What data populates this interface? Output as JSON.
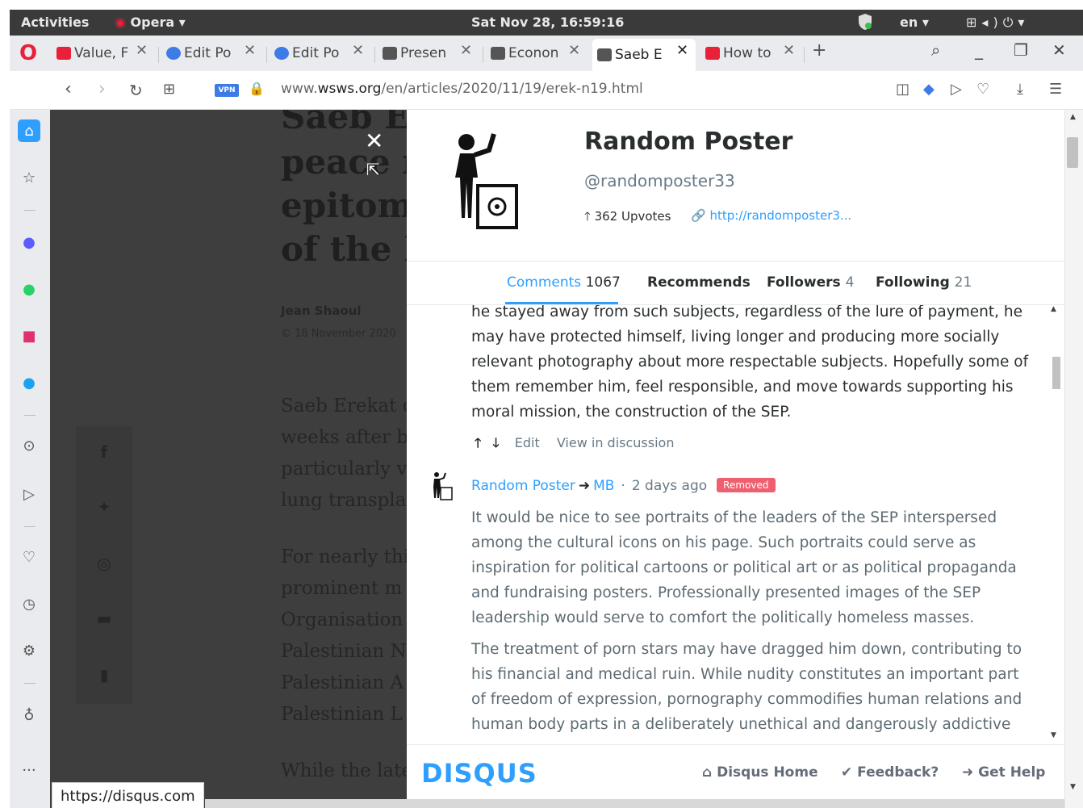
{
  "system_bar": {
    "activities": "Activities",
    "app_name": "Opera ▾",
    "clock": "Sat Nov 28, 16:59:16",
    "language": "en ▾"
  },
  "tabs": [
    {
      "label": "Value, F",
      "favicon": "youtube-icon",
      "color": "#e8203a"
    },
    {
      "label": "Edit Po",
      "favicon": "wordpress-icon",
      "color": "#3d7be6"
    },
    {
      "label": "Edit Po",
      "favicon": "wordpress-icon",
      "color": "#3d7be6"
    },
    {
      "label": "Presen",
      "favicon": "wsws-icon",
      "color": "#555"
    },
    {
      "label": "Econon",
      "favicon": "wsws-icon",
      "color": "#555"
    },
    {
      "label": "Saeb E",
      "favicon": "wsws-icon",
      "color": "#555",
      "active": true
    },
    {
      "label": "How to",
      "favicon": "youtube-icon",
      "color": "#e8203a"
    }
  ],
  "address_bar": {
    "vpn_label": "VPN",
    "url_prefix": "www.",
    "url_domain": "wsws.org",
    "url_path": "/en/articles/2020/11/19/erek-n19.html"
  },
  "article": {
    "title_lines": [
      "Saeb Er",
      "peace r",
      "epitom",
      "of the P"
    ],
    "author": "Jean Shaoul",
    "date": "© 18 November 2020",
    "paragraphs": [
      "Saeb Erekat d",
      "weeks after b",
      "particularly v",
      "lung transpla",
      "For nearly thi",
      "prominent m",
      "Organisation",
      "Palestinian N",
      "Palestinian A",
      "Palestinian L",
      "While the late"
    ]
  },
  "status_url": "https://disqus.com",
  "profile": {
    "name": "Random Poster",
    "handle": "@randomposter33",
    "upvotes": "362 Upvotes",
    "link": "http://randomposter3...",
    "tabs": [
      {
        "label": "Comments",
        "count": "1067",
        "active": true
      },
      {
        "label": "Recommends",
        "count": ""
      },
      {
        "label": "Followers",
        "count": "4"
      },
      {
        "label": "Following",
        "count": "21"
      }
    ]
  },
  "comments": {
    "first_tail": "he stayed away from such subjects, regardless of the lure of payment, he may have protected himself, living longer and producing more socially relevant photography about more respectable subjects. Hopefully some of them remember him, feel responsible, and move towards supporting his moral mission, the construction of the SEP.",
    "first_actions": {
      "edit": "Edit",
      "view": "View in discussion"
    },
    "second": {
      "author": "Random Poster",
      "reply_to": "MB",
      "time": "2 days ago",
      "badge": "Removed",
      "para1": "It would be nice to see portraits of the leaders of the SEP interspersed among the cultural icons on his page. Such portraits could serve as inspiration for political cartoons or political art or as political propaganda and fundraising posters. Professionally presented images of the SEP leadership would serve to comfort the politically homeless masses.",
      "para2": "The treatment of porn stars may have dragged him down, contributing to his financial and medical ruin. While nudity constitutes an important part of freedom of expression, pornography commodifies human relations and human body parts in a deliberately unethical and dangerously addictive manner. Had"
    }
  },
  "footer": {
    "logo": "DISQUS",
    "home": "Disqus Home",
    "feedback": "Feedback?",
    "help": "Get Help"
  }
}
